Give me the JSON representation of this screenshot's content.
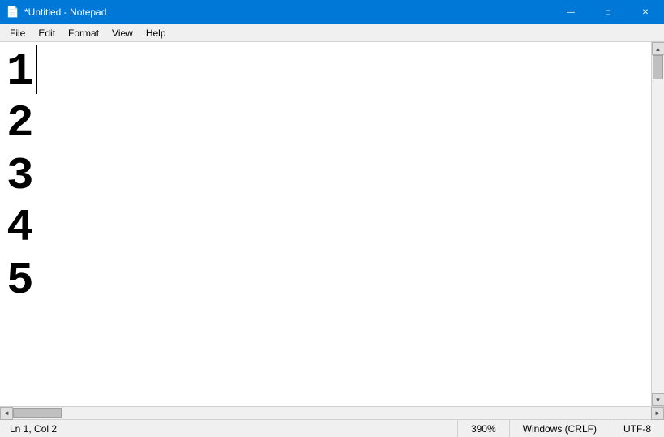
{
  "titlebar": {
    "title": "*Untitled - Notepad",
    "icon": "📄",
    "minimize_label": "—",
    "maximize_label": "□",
    "close_label": "✕"
  },
  "menubar": {
    "items": [
      {
        "label": "File"
      },
      {
        "label": "Edit"
      },
      {
        "label": "Format"
      },
      {
        "label": "View"
      },
      {
        "label": "Help"
      }
    ]
  },
  "editor": {
    "lines": [
      "1",
      "2",
      "3",
      "4",
      "5"
    ]
  },
  "statusbar": {
    "position": "Ln 1, Col 2",
    "zoom": "390%",
    "line_ending": "Windows (CRLF)",
    "encoding": "UTF-8"
  },
  "scrollbar": {
    "up_arrow": "▲",
    "down_arrow": "▼",
    "left_arrow": "◄",
    "right_arrow": "►"
  }
}
